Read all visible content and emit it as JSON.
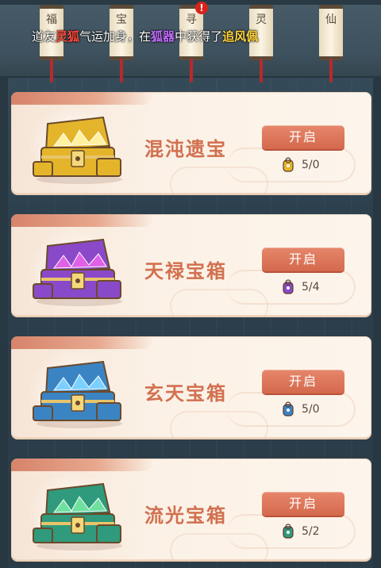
{
  "lanterns": [
    {
      "label": "福"
    },
    {
      "label": "宝"
    },
    {
      "label": "寻"
    },
    {
      "label": "灵"
    },
    {
      "label": "仙"
    }
  ],
  "lantern_notice_badge": "!",
  "marquee": {
    "prefix": "道友",
    "name": "灵狐",
    "middle": "气运加身，在",
    "source": "狐器",
    "middle2": "中获得了",
    "item": "追风佩"
  },
  "chests": [
    {
      "title": "混沌遗宝",
      "button": "开启",
      "count": "5/0",
      "color": "#e4b52a",
      "accent": "#fff1a0"
    },
    {
      "title": "天禄宝箱",
      "button": "开启",
      "count": "5/4",
      "color": "#8a49c8",
      "accent": "#e060e8"
    },
    {
      "title": "玄天宝箱",
      "button": "开启",
      "count": "5/0",
      "color": "#3b84c4",
      "accent": "#7ad0ff"
    },
    {
      "title": "流光宝箱",
      "button": "开启",
      "count": "5/2",
      "color": "#2f9a7c",
      "accent": "#6ee0a0"
    }
  ],
  "icons": [
    "chest-icon",
    "key-icon"
  ]
}
